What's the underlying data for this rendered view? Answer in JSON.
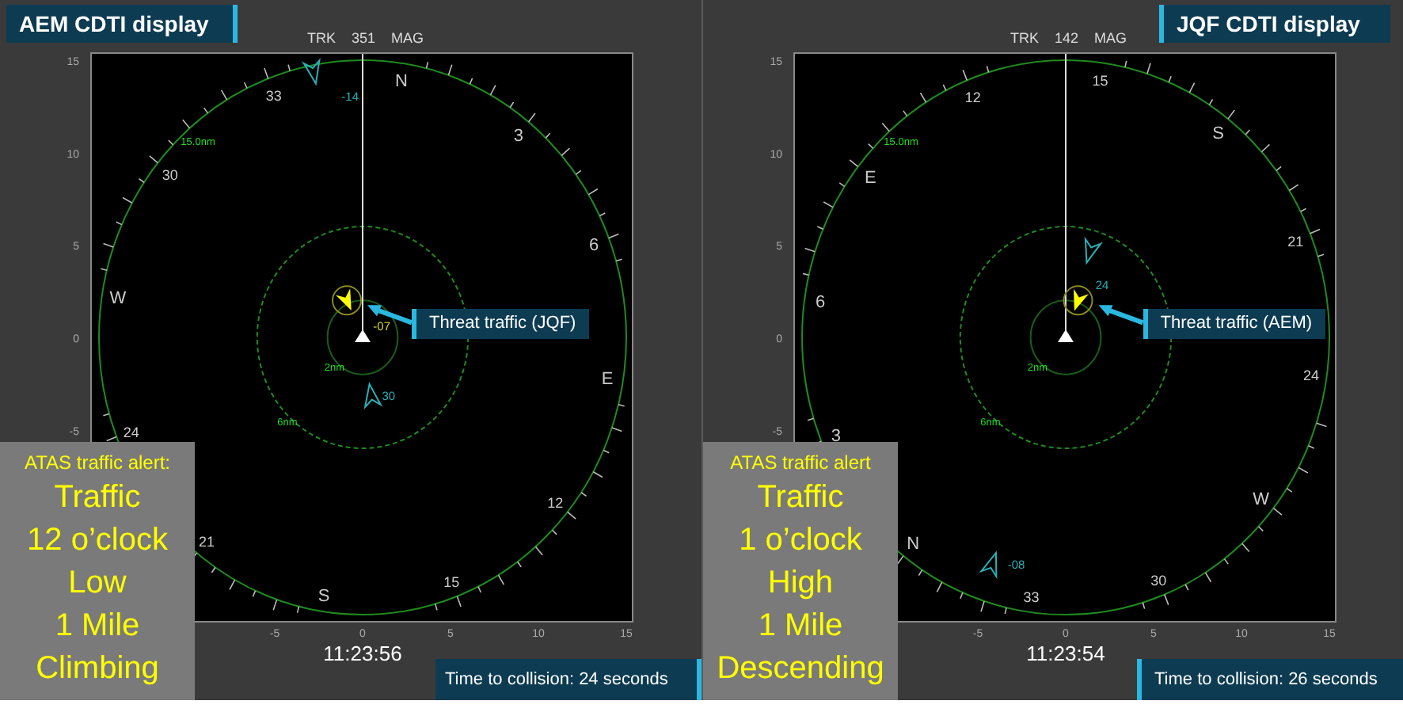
{
  "panels": [
    {
      "title": "AEM CDTI display",
      "track_label": "TRK",
      "track": "351",
      "track_ref": "MAG",
      "compass_labels": [
        "N",
        "3",
        "6",
        "E",
        "12",
        "15",
        "S",
        "21",
        "24",
        "W",
        "30",
        "33"
      ],
      "range_rings": [
        "15.0nm",
        "6nm",
        "2nm"
      ],
      "callout": "Threat traffic (JQF)",
      "y_axis_labels": [
        "15",
        "10",
        "5",
        "0",
        "-5"
      ],
      "x_axis_labels": [
        "-5",
        "0",
        "5",
        "10",
        "15"
      ],
      "altitude_tags": [
        "-14",
        "30",
        "-07"
      ],
      "alert": {
        "heading": "ATAS traffic alert:",
        "lines": [
          "Traffic",
          "12 o’clock",
          "Low",
          "1 Mile",
          "Climbing"
        ]
      },
      "time": "11:23:56",
      "collision": "Time to collision: 24 seconds"
    },
    {
      "title": "JQF CDTI display",
      "track_label": "TRK",
      "track": "142",
      "track_ref": "MAG",
      "compass_labels": [
        "N",
        "3",
        "6",
        "E",
        "12",
        "15",
        "S",
        "21",
        "24",
        "W",
        "30",
        "33"
      ],
      "range_rings": [
        "15.0nm",
        "6nm",
        "2nm"
      ],
      "callout": "Threat traffic (AEM)",
      "y_axis_labels": [
        "15",
        "10",
        "5",
        "0",
        "-5"
      ],
      "x_axis_labels": [
        "-5",
        "0",
        "5",
        "10",
        "15"
      ],
      "altitude_tags": [
        "24",
        "-08"
      ],
      "alert": {
        "heading": "ATAS traffic alert",
        "lines": [
          "Traffic",
          "1 o’clock",
          "High",
          "1 Mile",
          "Descending"
        ]
      },
      "time": "11:23:54",
      "collision": "Time to collision: 26 seconds"
    }
  ]
}
